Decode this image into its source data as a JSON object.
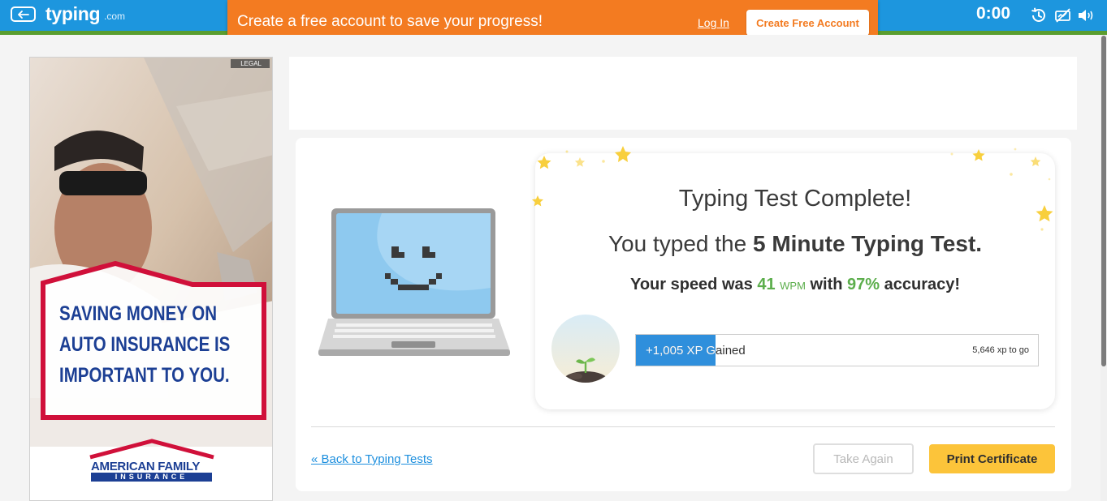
{
  "header": {
    "logo_text": "typing",
    "logo_suffix": ".com",
    "timer": "0:00",
    "icons": [
      "back-arrow-icon",
      "history-icon",
      "visibility-off-icon",
      "volume-icon"
    ]
  },
  "banner": {
    "message": "Create a free account to save your progress!",
    "login_label": "Log In",
    "create_label": "Create Free Account"
  },
  "ad": {
    "legal_label": "LEGAL",
    "headline_lines": [
      "SAVING MONEY ON",
      "AUTO INSURANCE IS",
      "IMPORTANT TO YOU."
    ],
    "brand_line1": "AMERICAN FAMILY",
    "brand_line2": "INSURANCE"
  },
  "result": {
    "title": "Typing Test Complete!",
    "subtitle_prefix": "You typed the ",
    "subtitle_test": "5 Minute Typing Test.",
    "speed_prefix": "Your speed was ",
    "speed_value": "41",
    "speed_unit": "WPM",
    "speed_middle": " with ",
    "accuracy_value": "97%",
    "speed_suffix": " accuracy!"
  },
  "xp": {
    "gained_label": "+1,005 XP Gained",
    "to_go_label": "5,646 xp to go",
    "progress_fraction": 0.197
  },
  "footer": {
    "back_label": "« Back to Typing Tests",
    "take_again_label": "Take Again",
    "print_label": "Print Certificate"
  },
  "colors": {
    "topbar_blue": "#1d96de",
    "banner_orange": "#f37b21",
    "accent_green": "#5cae4c",
    "xp_blue": "#2f8fdc",
    "print_yellow": "#fcc43a"
  }
}
